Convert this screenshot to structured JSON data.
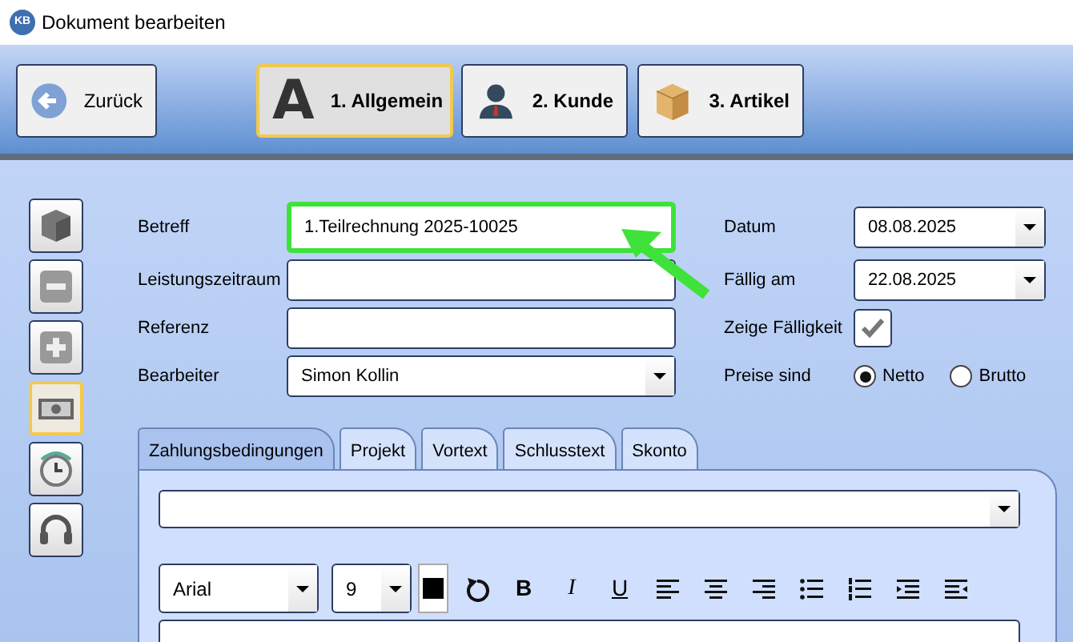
{
  "window": {
    "app_icon": "KB",
    "title": "Dokument bearbeiten"
  },
  "nav_buttons": [
    {
      "label": "Zurück",
      "kind": "back",
      "selected": false
    },
    {
      "label": "1. Allgemein",
      "kind": "letter",
      "icon_text": "A",
      "selected": true
    },
    {
      "label": "2. Kunde",
      "kind": "person",
      "selected": false
    },
    {
      "label": "3. Artikel",
      "kind": "box",
      "selected": false
    }
  ],
  "sidebar_buttons": [
    {
      "selected": false
    },
    {
      "selected": false
    },
    {
      "selected": false
    },
    {
      "selected": true
    },
    {
      "selected": false
    },
    {
      "selected": false
    }
  ],
  "fields": [
    {
      "label": "Betreff",
      "kind": "text",
      "value": "1.Teilrechnung 2025-10025",
      "highlighted": true
    },
    {
      "label": "Leistungszeitraum",
      "kind": "text",
      "highlighted": false
    },
    {
      "label": "Referenz",
      "kind": "text",
      "highlighted": false
    },
    {
      "label": "Bearbeiter",
      "kind": "select",
      "value": "Simon Kollin",
      "highlighted": false
    }
  ],
  "dates": [
    {
      "label": "Datum",
      "value": "08.08.2025"
    },
    {
      "label": "Fällig am",
      "value": "22.08.2025"
    }
  ],
  "show_due": {
    "label": "Zeige Fälligkeit",
    "checked": true
  },
  "prices": {
    "label": "Preise sind",
    "options": [
      {
        "label": "Netto",
        "selected": true
      },
      {
        "label": "Brutto",
        "selected": false
      }
    ]
  },
  "tabs": [
    {
      "label": "Zahlungsbedingungen",
      "selected": true
    },
    {
      "label": "Projekt",
      "selected": false
    },
    {
      "label": "Vortext",
      "selected": false
    },
    {
      "label": "Schlusstext",
      "selected": false
    },
    {
      "label": "Skonto",
      "selected": false
    }
  ],
  "editor": {
    "font": "Arial",
    "size": "9",
    "format_buttons": [
      "B",
      "I",
      "U"
    ]
  }
}
